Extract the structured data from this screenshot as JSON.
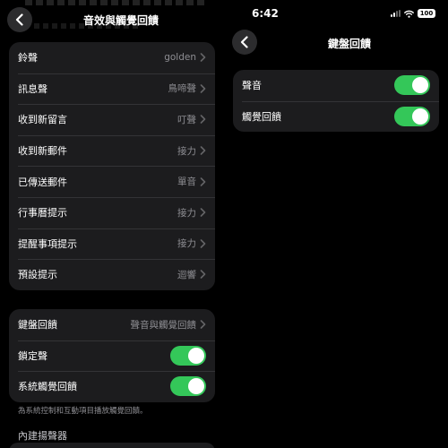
{
  "left": {
    "nav": {
      "title": "音效與觸覺回饋"
    },
    "sounds_group": [
      {
        "label": "鈴聲",
        "value": "golden"
      },
      {
        "label": "訊息聲",
        "value": "鳥啼聲"
      },
      {
        "label": "收到新留言",
        "value": "叮聲"
      },
      {
        "label": "收到新郵件",
        "value": "接力"
      },
      {
        "label": "已傳送郵件",
        "value": "單音"
      },
      {
        "label": "行事曆提示",
        "value": "接力"
      },
      {
        "label": "提醒事項提示",
        "value": "接力"
      },
      {
        "label": "預設提示",
        "value": "迴響"
      }
    ],
    "feedback_group": {
      "keyboard": {
        "label": "鍵盤回饋",
        "value": "聲音與觸覺回饋"
      },
      "lock_sound": {
        "label": "鎖定聲",
        "on": true
      },
      "system_haptics": {
        "label": "系統觸覺回饋",
        "on": true
      }
    },
    "footnote": "為系統控制和互動項目播放觸覺回饋。",
    "speaker_header": "內建揚聲器"
  },
  "right": {
    "status": {
      "time": "6:42",
      "battery": "100"
    },
    "nav": {
      "title": "鍵盤回饋"
    },
    "toggles": {
      "sound": {
        "label": "聲音",
        "on": true
      },
      "haptic": {
        "label": "觸覺回饋",
        "on": true
      }
    }
  },
  "colors": {
    "toggle_on": "#34c759",
    "group_bg": "#1c1c1e",
    "secondary_text": "#8e8e93"
  },
  "icons": [
    "back-chevron-icon",
    "chevron-right-icon",
    "cellular-signal-icon",
    "wifi-icon",
    "battery-icon"
  ]
}
